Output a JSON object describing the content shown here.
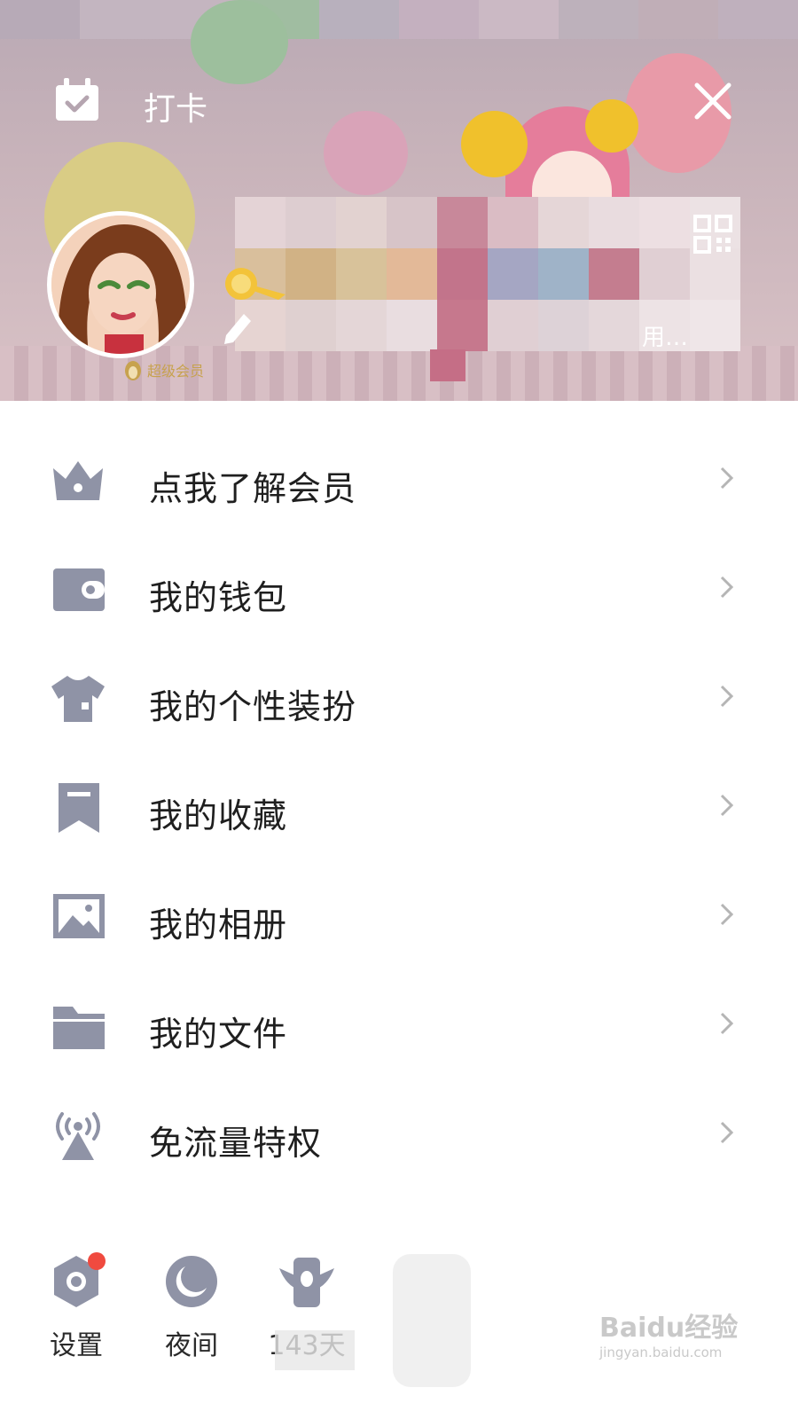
{
  "header": {
    "checkin_label": "打卡",
    "vip_label": "超级会员",
    "signature_text": "用…",
    "strip_colors": [
      "#b7aab7",
      "#c3b5c0",
      "#c4b5c0",
      "#a0bda1",
      "#b8b0bd",
      "#c4b0bf",
      "#cbb9c4",
      "#bdb1bb",
      "#c0aeb7",
      "#bfb0bd"
    ],
    "mosaic_colors": [
      "#e4d3d6",
      "#ddcdd0",
      "#e2d2d0",
      "#d7c4c8",
      "#c8889a",
      "#dabcc4",
      "#e5d6d7",
      "#e9dcdf",
      "#eddfe2",
      "#ece2e4",
      "#d9bf9c",
      "#d1b285",
      "#d8c29a",
      "#e3b998",
      "#c2748b",
      "#a5a6c3",
      "#9fb3c8",
      "#c47d8f",
      "#e0cfd3",
      "#ebe0e2",
      "#e6d4d2",
      "#dfd0d0",
      "#e4d6d7",
      "#e9dde0",
      "#c6788d",
      "#e0cfd3",
      "#ddd2d7",
      "#e4d7da",
      "#ede3e5",
      "#efe6e8"
    ]
  },
  "menu": {
    "items": [
      {
        "label": "点我了解会员",
        "icon": "crown-icon"
      },
      {
        "label": "我的钱包",
        "icon": "wallet-icon"
      },
      {
        "label": "我的个性装扮",
        "icon": "tshirt-icon"
      },
      {
        "label": "我的收藏",
        "icon": "bookmark-icon"
      },
      {
        "label": "我的相册",
        "icon": "photo-album-icon"
      },
      {
        "label": "我的文件",
        "icon": "folder-icon"
      },
      {
        "label": "免流量特权",
        "icon": "antenna-icon"
      }
    ]
  },
  "bottom": {
    "settings_label": "设置",
    "night_label": "夜间",
    "days_label": "143天"
  },
  "watermark": {
    "main": "Baidu经验",
    "sub": "jingyan.baidu.com"
  },
  "colors": {
    "icon_gray": "#8f93a6",
    "badge_red": "#f04a3f",
    "chevron": "#b5b5b5"
  }
}
